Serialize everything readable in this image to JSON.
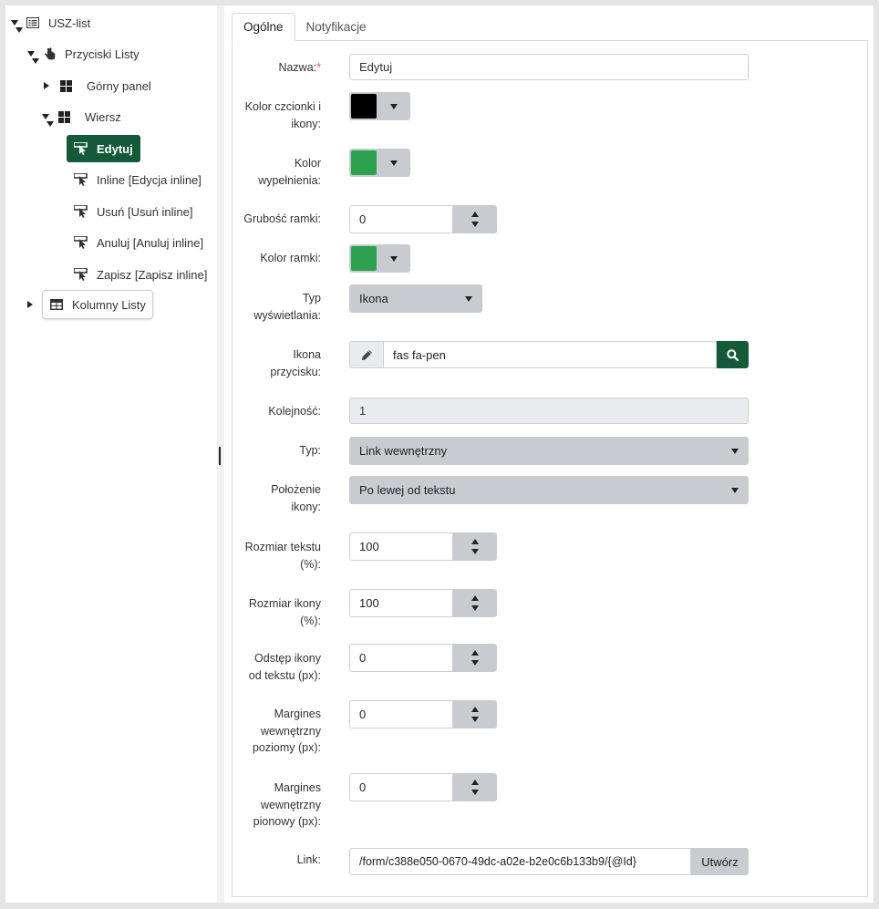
{
  "tree": {
    "root": "USZ-list",
    "buttons_group": "Przyciski Listy",
    "top_panel": "Górny panel",
    "row": "Wiersz",
    "items": [
      "Edytuj",
      "Inline [Edycja inline]",
      "Usuń [Usuń inline]",
      "Anuluj [Anuluj inline]",
      "Zapisz [Zapisz inline]"
    ],
    "columns_group": "Kolumny Listy"
  },
  "tabs": [
    "Ogólne",
    "Notyfikacje"
  ],
  "form": {
    "name": {
      "label": "Nazwa:",
      "required_mark": "*",
      "value": "Edytuj"
    },
    "font_color": {
      "label_lines": [
        "Kolor czcionki i",
        "ikony:"
      ],
      "color": "#000000"
    },
    "fill_color": {
      "label_lines": [
        "Kolor",
        "wypełnienia:"
      ],
      "color": "#2ca24f"
    },
    "border_width": {
      "label": "Grubość ramki:",
      "value": "0"
    },
    "border_color": {
      "label": "Kolor ramki:",
      "color": "#2ca24f"
    },
    "display_type": {
      "label_lines": [
        "Typ",
        "wyświetlania:"
      ],
      "value": "Ikona"
    },
    "button_icon": {
      "label_lines": [
        "Ikona",
        "przycisku:"
      ],
      "value": "fas fa-pen"
    },
    "order": {
      "label": "Kolejność:",
      "value": "1"
    },
    "type": {
      "label": "Typ:",
      "value": "Link wewnętrzny"
    },
    "icon_position": {
      "label_lines": [
        "Położenie",
        "ikony:"
      ],
      "value": "Po lewej od tekstu"
    },
    "text_size": {
      "label_lines": [
        "Rozmiar tekstu",
        "(%):"
      ],
      "value": "100"
    },
    "icon_size": {
      "label_lines": [
        "Rozmiar ikony",
        "(%):"
      ],
      "value": "100"
    },
    "icon_spacing": {
      "label_lines": [
        "Odstęp ikony",
        "od tekstu (px):"
      ],
      "value": "0"
    },
    "padding_h": {
      "label_lines": [
        "Margines",
        "wewnętrzny",
        "poziomy (px):"
      ],
      "value": "0"
    },
    "padding_v": {
      "label_lines": [
        "Margines",
        "wewnętrzny",
        "pionowy (px):"
      ],
      "value": "0"
    },
    "link": {
      "label": "Link:",
      "value": "/form/c388e050-0670-49dc-a02e-b2e0c6b133b9/{@Id}",
      "button": "Utwórz"
    }
  },
  "colors": {
    "accent": "#155a38"
  }
}
